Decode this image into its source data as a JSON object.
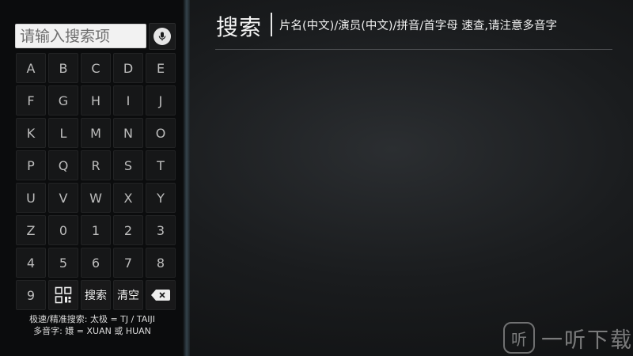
{
  "search": {
    "placeholder": "请输入搜索项",
    "voice_icon": "microphone-icon"
  },
  "keyboard": {
    "rows": [
      [
        "A",
        "B",
        "C",
        "D",
        "E"
      ],
      [
        "F",
        "G",
        "H",
        "I",
        "J"
      ],
      [
        "K",
        "L",
        "M",
        "N",
        "O"
      ],
      [
        "P",
        "Q",
        "R",
        "S",
        "T"
      ],
      [
        "U",
        "V",
        "W",
        "X",
        "Y"
      ],
      [
        "Z",
        "0",
        "1",
        "2",
        "3"
      ],
      [
        "4",
        "5",
        "6",
        "7",
        "8"
      ]
    ],
    "last_row": {
      "key_9": "9",
      "qr_icon": "qr-code-icon",
      "search_label": "搜索",
      "clear_label": "清空",
      "backspace_icon": "backspace-icon"
    }
  },
  "hints": {
    "line1": "极速/精准搜索: 太极 = TJ / TAIJI",
    "line2": "多音字: 嬛 = XUAN 或 HUAN"
  },
  "header": {
    "title": "搜索",
    "subtitle": "片名(中文)/演员(中文)/拼音/首字母 速查,请注意多音字"
  },
  "watermark": {
    "logo_char": "听",
    "text": "一听下载"
  }
}
